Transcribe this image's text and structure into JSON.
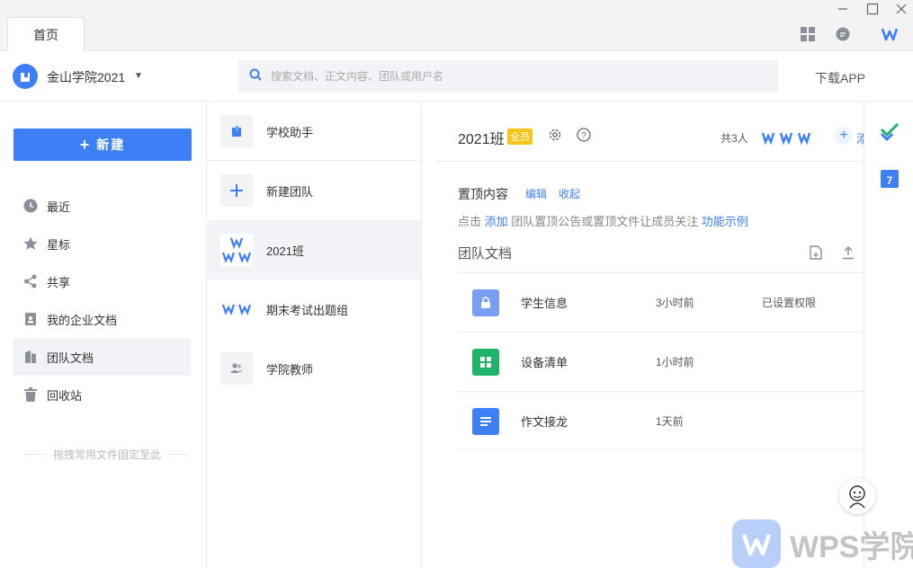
{
  "tabs": [
    {
      "label": "首页"
    }
  ],
  "header": {
    "org_name": "金山学院2021",
    "search_placeholder": "搜索文档、正文内容、团队或用户名",
    "download_app": "下载APP"
  },
  "sidebar": {
    "new_button": "新建",
    "items": [
      {
        "label": "最近",
        "icon": "clock-icon"
      },
      {
        "label": "星标",
        "icon": "star-icon"
      },
      {
        "label": "共享",
        "icon": "share-icon"
      },
      {
        "label": "我的企业文档",
        "icon": "enterprise-doc-icon"
      },
      {
        "label": "团队文档",
        "icon": "team-doc-icon"
      },
      {
        "label": "回收站",
        "icon": "trash-icon"
      }
    ],
    "drag_hint": "拖拽常用文件固定至此"
  },
  "teams": [
    {
      "name": "学校助手"
    },
    {
      "name": "新建团队"
    },
    {
      "name": "2021班"
    },
    {
      "name": "期末考试出题组"
    },
    {
      "name": "学院教师"
    }
  ],
  "main": {
    "team_name": "2021班",
    "badge": "全员",
    "member_count": "共3人",
    "add_label": "添",
    "pinned": {
      "title": "置顶内容",
      "edit": "编辑",
      "collapse": "收起",
      "desc_prefix": "点击",
      "desc_add": "添加",
      "desc_middle": "团队置顶公告或置顶文件让成员关注",
      "desc_example": "功能示例"
    },
    "docs_title": "团队文档",
    "documents": [
      {
        "name": "学生信息",
        "time": "3小时前",
        "permission": "已设置权限",
        "type": "locked-folder",
        "color": "#7a9df5"
      },
      {
        "name": "设备清单",
        "time": "1小时前",
        "permission": "",
        "type": "spreadsheet",
        "color": "#1fb469"
      },
      {
        "name": "作文接龙",
        "time": "1天前",
        "permission": "",
        "type": "document",
        "color": "#3d7ff5"
      }
    ]
  },
  "rightrail": {
    "calendar_day": "7"
  },
  "watermark": {
    "text": "WPS学院"
  },
  "colors": {
    "accent": "#3d7ff5",
    "badge": "#f5c518"
  }
}
